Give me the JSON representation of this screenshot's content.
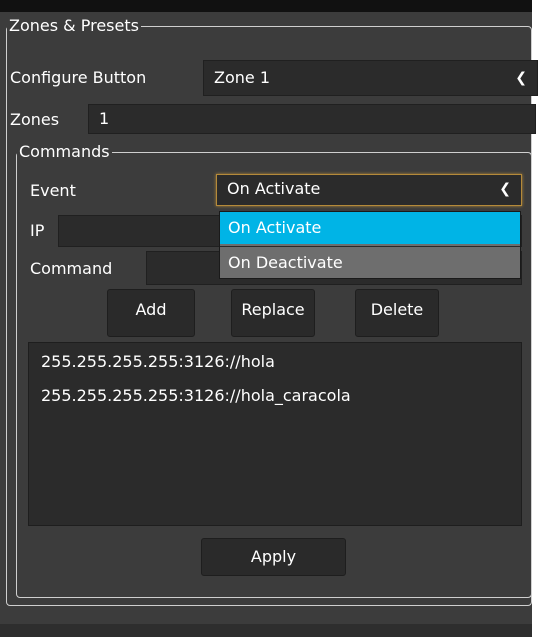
{
  "outer_group": {
    "title": "Zones & Presets"
  },
  "configure": {
    "label": "Configure Button",
    "value": "Zone 1"
  },
  "zones": {
    "label": "Zones",
    "value": "1"
  },
  "commands_group": {
    "title": "Commands"
  },
  "event": {
    "label": "Event",
    "value": "On Activate",
    "options": [
      "On Activate",
      "On Deactivate"
    ]
  },
  "ip": {
    "label": "IP",
    "value": ""
  },
  "command": {
    "label": "Command",
    "value": ""
  },
  "buttons": {
    "add": "Add",
    "replace": "Replace",
    "delete": "Delete",
    "apply": "Apply"
  },
  "commands_list": [
    "255.255.255.255:3126://hola",
    "255.255.255.255:3126://hola_caracola"
  ],
  "colors": {
    "accent": "#00b4e6",
    "focus": "#b58a3a",
    "panel": "#3c3c3c",
    "field": "#2b2b2b"
  },
  "icons": {
    "chevron": "chevron-down-icon"
  }
}
